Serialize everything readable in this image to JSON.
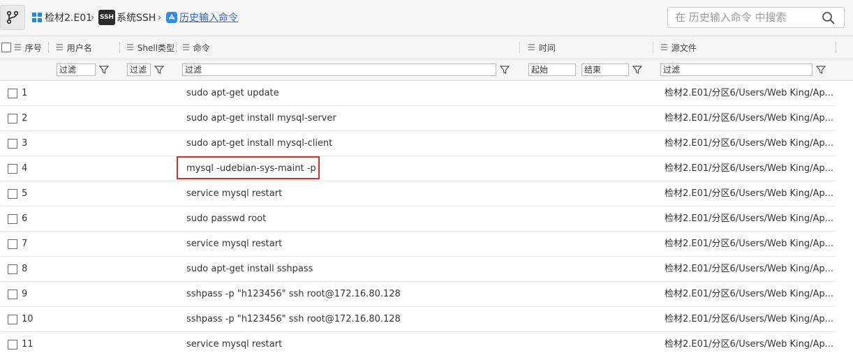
{
  "breadcrumb": {
    "items": [
      {
        "label": "检材2.E01",
        "icon": "windows-icon"
      },
      {
        "label": "系统SSH",
        "icon": "ssh-icon",
        "icon_text": "SSH"
      },
      {
        "label": "历史输入命令",
        "icon": "app-store-icon"
      }
    ],
    "separator": "›"
  },
  "search": {
    "placeholder": "在 历史输入命令 中搜索"
  },
  "columns": {
    "index": "序号",
    "user": "用户名",
    "shell": "Shell类型",
    "command": "命令",
    "time": "时间",
    "source": "源文件"
  },
  "filters": {
    "user": "过滤",
    "shell": "过滤",
    "command": "过滤",
    "time_start": "起始",
    "time_end": "结束",
    "source": "过滤"
  },
  "rows": [
    {
      "index": "1",
      "command": "sudo apt-get update",
      "source": "检材2.E01/分区6/Users/Web King/Ap..."
    },
    {
      "index": "2",
      "command": "sudo apt-get install mysql-server",
      "source": "检材2.E01/分区6/Users/Web King/Ap..."
    },
    {
      "index": "3",
      "command": "sudo apt-get install mysql-client",
      "source": "检材2.E01/分区6/Users/Web King/Ap..."
    },
    {
      "index": "4",
      "command": "mysql -udebian-sys-maint -p",
      "source": "检材2.E01/分区6/Users/Web King/Ap..."
    },
    {
      "index": "5",
      "command": "service mysql restart",
      "source": "检材2.E01/分区6/Users/Web King/Ap..."
    },
    {
      "index": "6",
      "command": "sudo passwd root",
      "source": "检材2.E01/分区6/Users/Web King/Ap..."
    },
    {
      "index": "7",
      "command": "service mysql restart",
      "source": "检材2.E01/分区6/Users/Web King/Ap..."
    },
    {
      "index": "8",
      "command": "sudo apt-get install sshpass",
      "source": "检材2.E01/分区6/Users/Web King/Ap..."
    },
    {
      "index": "9",
      "command": "sshpass -p \"h123456\" ssh root@172.16.80.128",
      "source": "检材2.E01/分区6/Users/Web King/Ap..."
    },
    {
      "index": "10",
      "command": "sshpass -p \"h123456\" ssh root@172.16.80.128",
      "source": "检材2.E01/分区6/Users/Web King/Ap..."
    },
    {
      "index": "11",
      "command": "service mysql restart",
      "source": "检材2.E01/分区6/Users/Web King/Ap..."
    }
  ],
  "colors": {
    "highlight": "#d32f2f",
    "link": "#3a67c4",
    "windows": "#1e88e5"
  }
}
